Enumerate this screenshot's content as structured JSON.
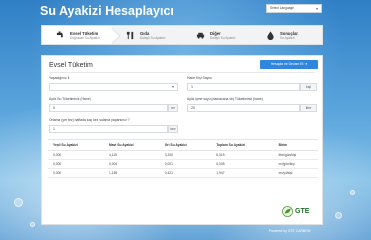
{
  "header": {
    "title": "Su Ayakizi Hesaplayıcı",
    "language_select": "Select Language"
  },
  "steps": [
    {
      "title": "Evsel Tüketim",
      "subtitle": "Doğrudan Su Ayakizi"
    },
    {
      "title": "Gıda",
      "subtitle": "Dolaylı Su Ayakizi"
    },
    {
      "title": "Diğer",
      "subtitle": "Dolaylı Su Ayakizi"
    },
    {
      "title": "Sonuçlar",
      "subtitle": "Su Ayakizi"
    }
  ],
  "panel": {
    "title": "Evsel Tüketim",
    "next_button": "Hesapla ve Devam Et",
    "fields": {
      "location_label": "Yaşadığınız İl",
      "location_value": "",
      "people_label": "Hane Kişi Sayısı",
      "people_value": "1",
      "people_unit": "kişi",
      "monthly_water_label": "Aylık Su Tüketiminiz (Hane)",
      "monthly_water_value": "0",
      "monthly_water_unit": "m³",
      "daily_per_person_label": "Aylık içme suyu (damacana vb) Tüketiminiz (hane)",
      "daily_per_person_value": "20",
      "daily_per_person_unit": "litre",
      "garden_label": "Ortama (yer tez) haftada kaç kez sulama yaparsınız ?",
      "garden_value": "1",
      "garden_unit": "kez"
    }
  },
  "table": {
    "headers": [
      "Yeşil Su Ayakizi",
      "Mavi Su Ayakizi",
      "Gri Su Ayakizi",
      "Toplam Su Ayakizi",
      "Birim"
    ],
    "rows": [
      [
        "0,000",
        "4,115",
        "3,200",
        "6,315",
        "litre/gün/kişi"
      ],
      [
        "0,000",
        "0,004",
        "0,001",
        "0,005",
        "m³/gün/kişi"
      ],
      [
        "0,000",
        "1,159",
        "0,421",
        "1,947",
        "m³/yıl/kişi"
      ]
    ]
  },
  "logo": {
    "text": "GTE"
  },
  "footer": {
    "text": "Powered by GTE CARBON"
  },
  "colors": {
    "accent": "#2e86de",
    "logo_green": "#1f6f2a"
  }
}
